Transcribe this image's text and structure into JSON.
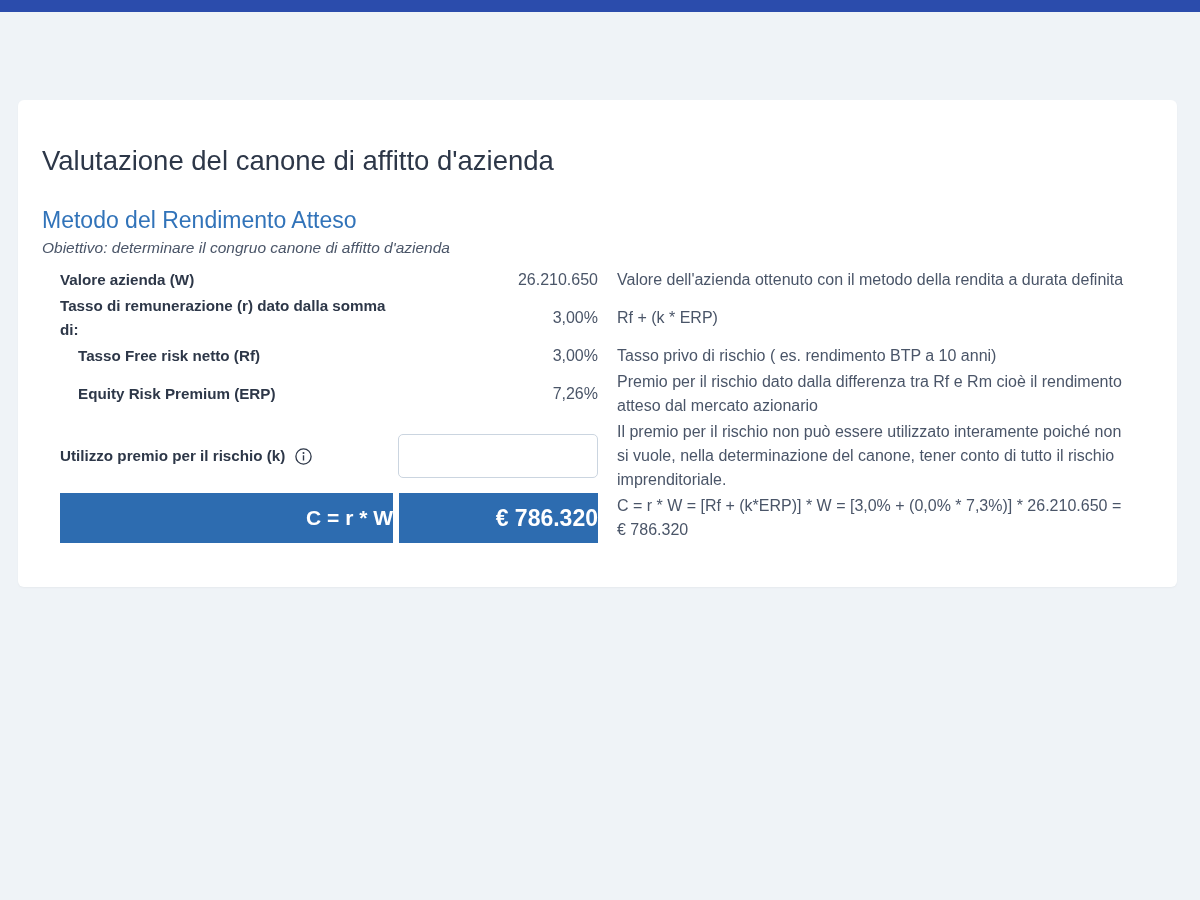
{
  "title": "Valutazione del canone di affitto d'azienda",
  "section": {
    "title": "Metodo del Rendimento Atteso",
    "objective": "Obiettivo: determinare il congruo canone di affitto d'azienda"
  },
  "rows": [
    {
      "kind": "value",
      "label": "Valore azienda (W)",
      "value": "26.210.650",
      "description": "Valore dell'azienda ottenuto con il metodo della rendita a durata definita"
    },
    {
      "kind": "value",
      "label": "Tasso di remunerazione (r) dato dalla somma di:",
      "value": "3,00%",
      "description": "Rf + (k * ERP)",
      "children": [
        {
          "kind": "value",
          "label": "Tasso Free risk netto (Rf)",
          "value": "3,00%",
          "description": "Tasso privo di rischio ( es. rendimento BTP a 10 anni)"
        },
        {
          "kind": "value",
          "label": "Equity Risk Premium (ERP)",
          "value": "7,26%",
          "description": "Premio per il rischio dato dalla differenza tra Rf e Rm cioè il rendimento atteso dal mercato azionario"
        }
      ]
    },
    {
      "kind": "input",
      "label": "Utilizzo premio per il rischio (k)",
      "description": "Il premio per il rischio non può essere utilizzato interamente poiché non si vuole, nella determinazione del canone, tener conto di tutto il rischio imprenditoriale."
    },
    {
      "kind": "result",
      "label": "C = r * W",
      "value": "€ 786.320",
      "description": "C = r * W = [Rf + (k*ERP)] * W = [3,0% + (0,0% * 7,3%)] * 26.210.650 = € 786.320"
    }
  ]
}
